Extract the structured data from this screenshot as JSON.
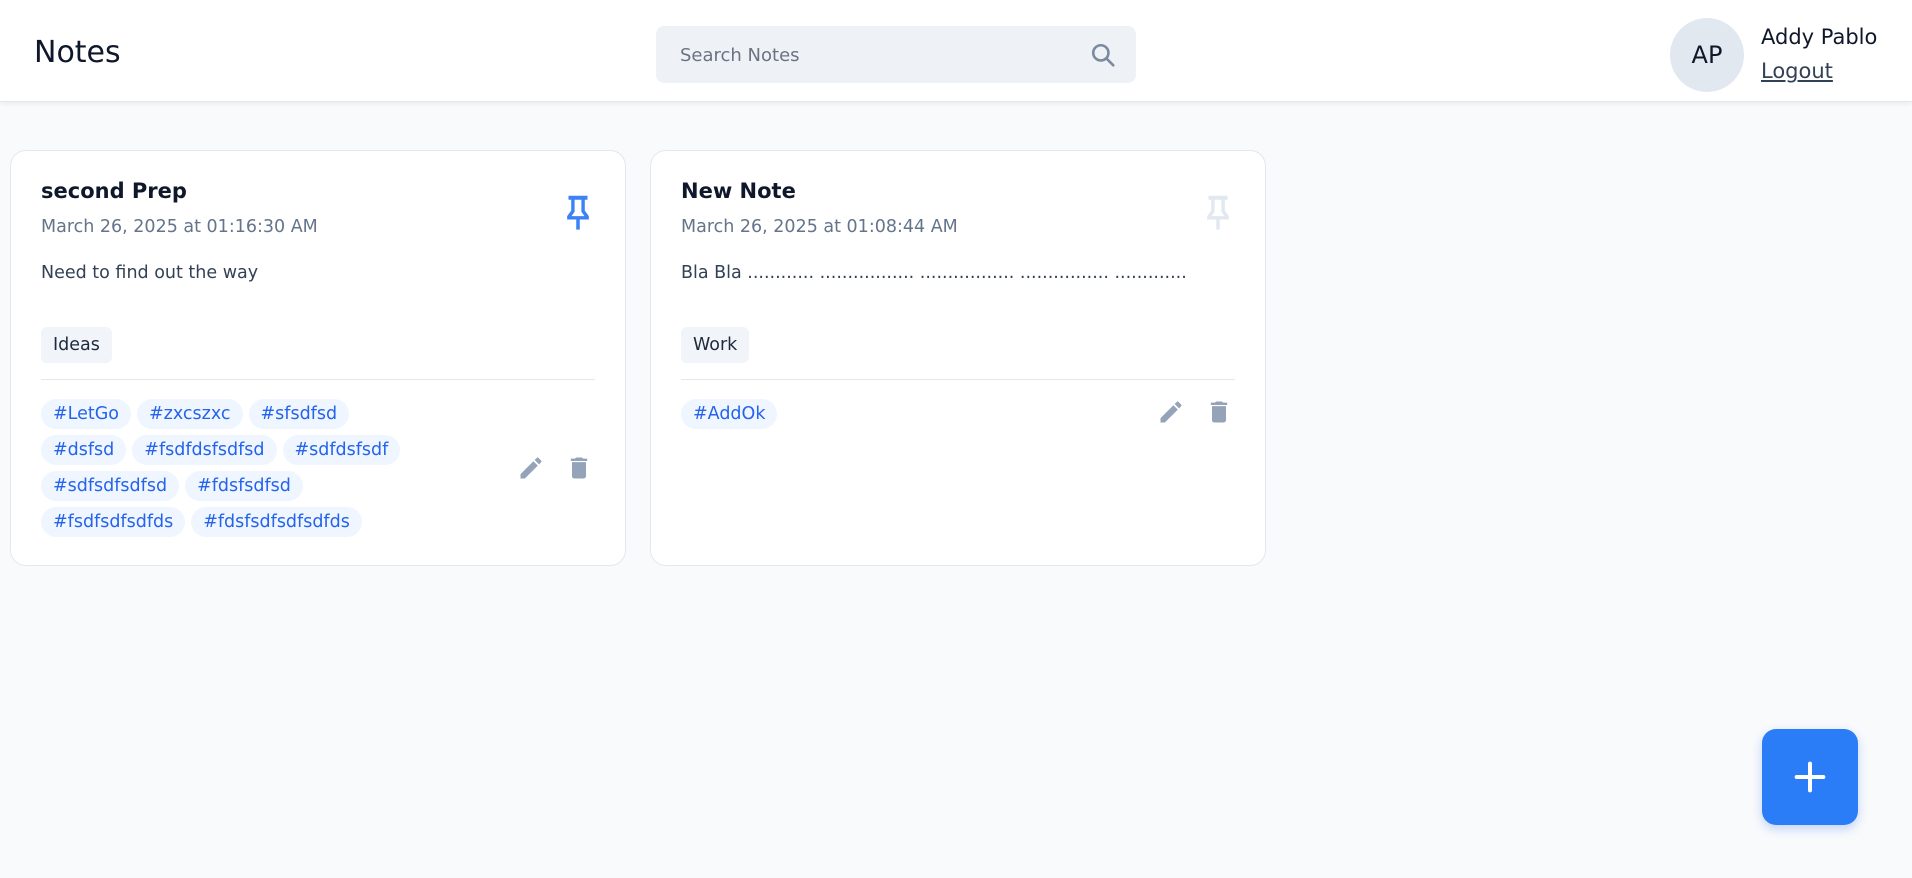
{
  "app": {
    "title": "Notes"
  },
  "search": {
    "placeholder": "Search Notes",
    "value": ""
  },
  "user": {
    "initials": "AP",
    "name": "Addy Pablo",
    "logout_label": "Logout"
  },
  "notes": [
    {
      "title": "second Prep",
      "date": "March 26, 2025 at 01:16:30 AM",
      "content": "Need to find out the way",
      "category": "Ideas",
      "pinned": true,
      "tags": [
        "#LetGo",
        "#zxcszxc",
        "#sfsdfsd",
        "#dsfsd",
        "#fsdfdsfsdfsd",
        "#sdfdsfsdf",
        "#sdfsdfsdfsd",
        "#fdsfsdfsd",
        "#fsdfsdfsdfds",
        "#fdsfsdfsdfsdfds"
      ]
    },
    {
      "title": "New Note",
      "date": "March 26, 2025 at 01:08:44 AM",
      "content": "Bla Bla ............ ................. ................. ................ .............",
      "category": "Work",
      "pinned": false,
      "tags": [
        "#AddOk"
      ]
    }
  ],
  "icons": {
    "search": "search-icon",
    "pin": "pin-icon",
    "edit": "pencil-icon",
    "delete": "trash-icon",
    "add": "plus-icon"
  },
  "colors": {
    "accent": "#2b7cf7",
    "tag_text": "#2563eb",
    "tag_bg": "#eff6ff",
    "pin_inactive": "#e2e8f0",
    "action_icon": "#94a3b8"
  }
}
